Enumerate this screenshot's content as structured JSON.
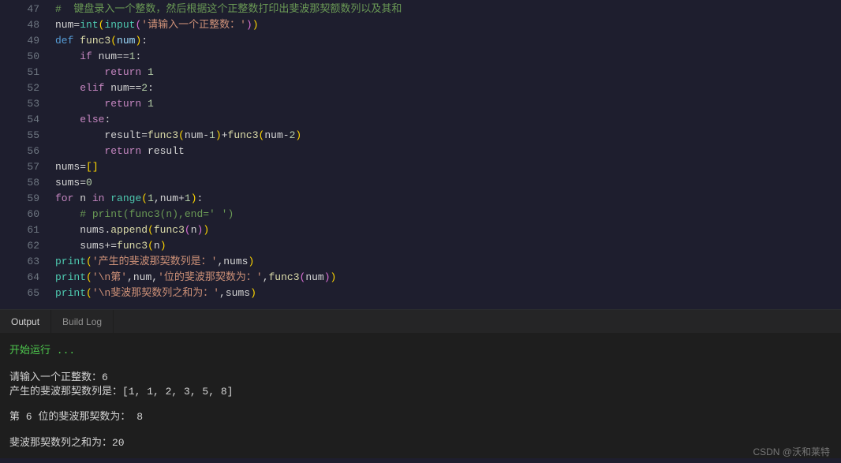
{
  "editor": {
    "lines": [
      {
        "no": "47",
        "tokens": [
          {
            "t": "#  键盘录入一个整数，然后根据这个正整数打印出斐波那契额数列以及其和",
            "c": "c-comment"
          }
        ]
      },
      {
        "no": "48",
        "tokens": [
          {
            "t": "num",
            "c": "c-ident"
          },
          {
            "t": "=",
            "c": "c-op"
          },
          {
            "t": "int",
            "c": "c-builtin"
          },
          {
            "t": "(",
            "c": "c-paren"
          },
          {
            "t": "input",
            "c": "c-builtin"
          },
          {
            "t": "(",
            "c": "c-paren2"
          },
          {
            "t": "'请输入一个正整数：'",
            "c": "c-string"
          },
          {
            "t": ")",
            "c": "c-paren2"
          },
          {
            "t": ")",
            "c": "c-paren"
          }
        ]
      },
      {
        "no": "49",
        "tokens": [
          {
            "t": "def ",
            "c": "c-def"
          },
          {
            "t": "func3",
            "c": "c-func"
          },
          {
            "t": "(",
            "c": "c-paren"
          },
          {
            "t": "num",
            "c": "c-param"
          },
          {
            "t": ")",
            "c": "c-paren"
          },
          {
            "t": ":",
            "c": "c-op"
          }
        ]
      },
      {
        "no": "50",
        "indent": 1,
        "tokens": [
          {
            "t": "    ",
            "c": ""
          },
          {
            "t": "if ",
            "c": "c-keyword"
          },
          {
            "t": "num",
            "c": "c-ident"
          },
          {
            "t": "==",
            "c": "c-op"
          },
          {
            "t": "1",
            "c": "c-number"
          },
          {
            "t": ":",
            "c": "c-op"
          }
        ]
      },
      {
        "no": "51",
        "indent": 2,
        "tokens": [
          {
            "t": "        ",
            "c": ""
          },
          {
            "t": "return ",
            "c": "c-keyword"
          },
          {
            "t": "1",
            "c": "c-number"
          }
        ]
      },
      {
        "no": "52",
        "indent": 1,
        "tokens": [
          {
            "t": "    ",
            "c": ""
          },
          {
            "t": "elif ",
            "c": "c-keyword"
          },
          {
            "t": "num",
            "c": "c-ident"
          },
          {
            "t": "==",
            "c": "c-op"
          },
          {
            "t": "2",
            "c": "c-number"
          },
          {
            "t": ":",
            "c": "c-op"
          }
        ]
      },
      {
        "no": "53",
        "indent": 2,
        "tokens": [
          {
            "t": "        ",
            "c": ""
          },
          {
            "t": "return ",
            "c": "c-keyword"
          },
          {
            "t": "1",
            "c": "c-number"
          }
        ]
      },
      {
        "no": "54",
        "indent": 1,
        "tokens": [
          {
            "t": "    ",
            "c": ""
          },
          {
            "t": "else",
            "c": "c-keyword"
          },
          {
            "t": ":",
            "c": "c-op"
          }
        ]
      },
      {
        "no": "55",
        "indent": 2,
        "tokens": [
          {
            "t": "        ",
            "c": ""
          },
          {
            "t": "result",
            "c": "c-ident"
          },
          {
            "t": "=",
            "c": "c-op"
          },
          {
            "t": "func3",
            "c": "c-func"
          },
          {
            "t": "(",
            "c": "c-paren"
          },
          {
            "t": "num",
            "c": "c-ident"
          },
          {
            "t": "-",
            "c": "c-op"
          },
          {
            "t": "1",
            "c": "c-number"
          },
          {
            "t": ")",
            "c": "c-paren"
          },
          {
            "t": "+",
            "c": "c-op"
          },
          {
            "t": "func3",
            "c": "c-func"
          },
          {
            "t": "(",
            "c": "c-paren"
          },
          {
            "t": "num",
            "c": "c-ident"
          },
          {
            "t": "-",
            "c": "c-op"
          },
          {
            "t": "2",
            "c": "c-number"
          },
          {
            "t": ")",
            "c": "c-paren"
          }
        ]
      },
      {
        "no": "56",
        "indent": 2,
        "tokens": [
          {
            "t": "        ",
            "c": ""
          },
          {
            "t": "return ",
            "c": "c-keyword"
          },
          {
            "t": "result",
            "c": "c-ident"
          }
        ]
      },
      {
        "no": "57",
        "tokens": [
          {
            "t": "nums",
            "c": "c-ident"
          },
          {
            "t": "=",
            "c": "c-op"
          },
          {
            "t": "[]",
            "c": "c-paren"
          }
        ]
      },
      {
        "no": "58",
        "tokens": [
          {
            "t": "sums",
            "c": "c-ident"
          },
          {
            "t": "=",
            "c": "c-op"
          },
          {
            "t": "0",
            "c": "c-number"
          }
        ]
      },
      {
        "no": "59",
        "tokens": [
          {
            "t": "for ",
            "c": "c-keyword"
          },
          {
            "t": "n ",
            "c": "c-ident"
          },
          {
            "t": "in ",
            "c": "c-keyword"
          },
          {
            "t": "range",
            "c": "c-builtin"
          },
          {
            "t": "(",
            "c": "c-paren"
          },
          {
            "t": "1",
            "c": "c-number"
          },
          {
            "t": ",",
            "c": "c-op"
          },
          {
            "t": "num",
            "c": "c-ident"
          },
          {
            "t": "+",
            "c": "c-op"
          },
          {
            "t": "1",
            "c": "c-number"
          },
          {
            "t": ")",
            "c": "c-paren"
          },
          {
            "t": ":",
            "c": "c-op"
          }
        ]
      },
      {
        "no": "60",
        "indent": 1,
        "tokens": [
          {
            "t": "    ",
            "c": ""
          },
          {
            "t": "# print(func3(n),end=' ')",
            "c": "c-comment"
          }
        ]
      },
      {
        "no": "61",
        "indent": 1,
        "tokens": [
          {
            "t": "    ",
            "c": ""
          },
          {
            "t": "nums",
            "c": "c-ident"
          },
          {
            "t": ".",
            "c": "c-op"
          },
          {
            "t": "append",
            "c": "c-func"
          },
          {
            "t": "(",
            "c": "c-paren"
          },
          {
            "t": "func3",
            "c": "c-func"
          },
          {
            "t": "(",
            "c": "c-paren2"
          },
          {
            "t": "n",
            "c": "c-ident"
          },
          {
            "t": ")",
            "c": "c-paren2"
          },
          {
            "t": ")",
            "c": "c-paren"
          }
        ]
      },
      {
        "no": "62",
        "indent": 1,
        "tokens": [
          {
            "t": "    ",
            "c": ""
          },
          {
            "t": "sums",
            "c": "c-ident"
          },
          {
            "t": "+=",
            "c": "c-op"
          },
          {
            "t": "func3",
            "c": "c-func"
          },
          {
            "t": "(",
            "c": "c-paren"
          },
          {
            "t": "n",
            "c": "c-ident"
          },
          {
            "t": ")",
            "c": "c-paren"
          }
        ]
      },
      {
        "no": "63",
        "tokens": [
          {
            "t": "print",
            "c": "c-builtin"
          },
          {
            "t": "(",
            "c": "c-paren"
          },
          {
            "t": "'产生的斐波那契数列是：'",
            "c": "c-string"
          },
          {
            "t": ",",
            "c": "c-op"
          },
          {
            "t": "nums",
            "c": "c-ident"
          },
          {
            "t": ")",
            "c": "c-paren"
          }
        ]
      },
      {
        "no": "64",
        "tokens": [
          {
            "t": "print",
            "c": "c-builtin"
          },
          {
            "t": "(",
            "c": "c-paren"
          },
          {
            "t": "'\\n第'",
            "c": "c-string"
          },
          {
            "t": ",",
            "c": "c-op"
          },
          {
            "t": "num",
            "c": "c-ident"
          },
          {
            "t": ",",
            "c": "c-op"
          },
          {
            "t": "'位的斐波那契数为：'",
            "c": "c-string"
          },
          {
            "t": ",",
            "c": "c-op"
          },
          {
            "t": "func3",
            "c": "c-func"
          },
          {
            "t": "(",
            "c": "c-paren2"
          },
          {
            "t": "num",
            "c": "c-ident"
          },
          {
            "t": ")",
            "c": "c-paren2"
          },
          {
            "t": ")",
            "c": "c-paren"
          }
        ]
      },
      {
        "no": "65",
        "tokens": [
          {
            "t": "print",
            "c": "c-builtin"
          },
          {
            "t": "(",
            "c": "c-paren"
          },
          {
            "t": "'\\n斐波那契数列之和为：'",
            "c": "c-string"
          },
          {
            "t": ",",
            "c": "c-op"
          },
          {
            "t": "sums",
            "c": "c-ident"
          },
          {
            "t": ")",
            "c": "c-paren"
          }
        ]
      }
    ]
  },
  "tabs": {
    "output": "Output",
    "buildlog": "Build Log"
  },
  "output": {
    "running": "开始运行 ...",
    "lines": [
      "请输入一个正整数：6",
      "产生的斐波那契数列是：[1, 1, 2, 3, 5, 8]",
      "",
      "第 6 位的斐波那契数为： 8",
      "",
      "斐波那契数列之和为：20"
    ]
  },
  "watermark": "CSDN @沃和莱特"
}
